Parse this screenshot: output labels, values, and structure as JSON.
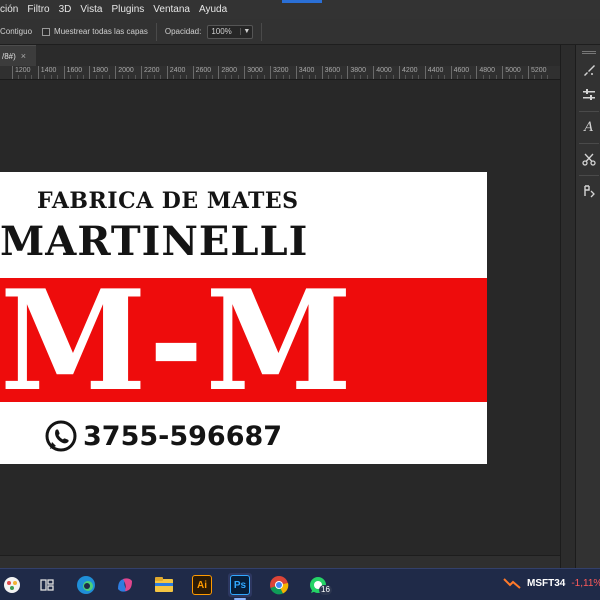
{
  "menubar": {
    "items": [
      "ción",
      "Filtro",
      "3D",
      "Vista",
      "Plugins",
      "Ventana",
      "Ayuda"
    ]
  },
  "options": {
    "contiguous_label": "Contiguo",
    "sample_all_label": "Muestrear todas las capas",
    "opacity_label": "Opacidad:",
    "opacity_value": "100%"
  },
  "tab": {
    "label": "/8#)",
    "close": "×"
  },
  "ruler": {
    "labels": [
      "1200",
      "1400",
      "1600",
      "1800",
      "2000",
      "2200",
      "2400",
      "2600",
      "2800",
      "3000",
      "3200",
      "3400",
      "3600",
      "3800",
      "4000",
      "4200",
      "4400",
      "4600",
      "4800",
      "5000",
      "5200"
    ]
  },
  "artwork": {
    "line1": "FABRICA DE MATES",
    "line2": "MARTINELLI",
    "monogram": "M-M",
    "phone": "3755-596687",
    "colors": {
      "red": "#ee0c0c",
      "ink": "#141414",
      "white": "#ffffff"
    }
  },
  "right_tools": [
    "brush-settings-icon",
    "adjust-sliders-icon",
    "character-icon",
    "scissors-icon",
    "paragraph-icon"
  ],
  "taskbar": {
    "apps": [
      "start",
      "task-view",
      "edge",
      "copilot",
      "file-explorer",
      "illustrator",
      "photoshop",
      "chrome",
      "whatsapp"
    ],
    "ai_label": "Ai",
    "ps_label": "Ps",
    "whatsapp_badge": "16",
    "ticker_symbol": "MSFT34",
    "ticker_change": "-1,11%"
  }
}
